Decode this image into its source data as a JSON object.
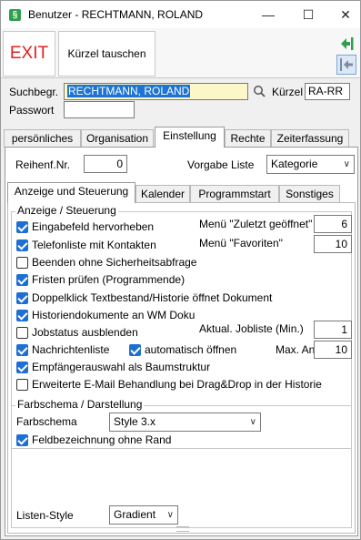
{
  "window": {
    "title": "Benutzer - RECHTMANN, ROLAND",
    "icon_glyph": "§",
    "controls": {
      "minimize": "—",
      "maximize": "☐",
      "close": "✕"
    }
  },
  "toolbar": {
    "exit_label": "EXIT",
    "kuerzel_tauschen_label": "Kürzel tauschen",
    "arrow_icons": [
      "arrow-in-icon",
      "arrow-out-icon"
    ]
  },
  "search": {
    "label": "Suchbegr.",
    "value": "RECHTMANN, ROLAND",
    "kuerzel_label": "Kürzel",
    "kuerzel_value": "RA-RR",
    "passwort_label": "Passwort",
    "passwort_value": ""
  },
  "main_tabs": [
    "persönliches",
    "Organisation",
    "Einstellung",
    "Rechte",
    "Zeiterfassung"
  ],
  "main_tab_active": "Einstellung",
  "einstellung": {
    "reihenf_label": "Reihenf.Nr.",
    "reihenf_value": "0",
    "vorgabe_label": "Vorgabe Liste",
    "vorgabe_value": "Kategorie"
  },
  "sub_tabs": [
    "Anzeige und Steuerung",
    "Kalender",
    "Programmstart",
    "Sonstiges"
  ],
  "sub_tab_active": "Anzeige und Steuerung",
  "anzeige": {
    "group_title": "Anzeige / Steuerung",
    "checkboxes": [
      {
        "label": "Eingabefeld hervorheben",
        "checked": true
      },
      {
        "label": "Telefonliste mit Kontakten",
        "checked": true
      },
      {
        "label": "Beenden ohne Sicherheitsabfrage",
        "checked": false
      },
      {
        "label": "Fristen prüfen (Programmende)",
        "checked": true
      },
      {
        "label": "Doppelklick Textbestand/Historie öffnet Dokument",
        "checked": true
      },
      {
        "label": "Historiendokumente an WM Doku",
        "checked": true
      },
      {
        "label": "Jobstatus ausblenden",
        "checked": false
      },
      {
        "label": "Nachrichtenliste",
        "checked": true
      },
      {
        "label": "automatisch öffnen",
        "checked": true
      },
      {
        "label": "Empfängerauswahl als Baumstruktur",
        "checked": true
      },
      {
        "label": "Erweiterte E-Mail Behandlung bei Drag&Drop in der Historie",
        "checked": false
      }
    ],
    "menue_zuletzt_label": "Menü \"Zuletzt geöffnet\"",
    "menue_zuletzt_value": "6",
    "menue_favoriten_label": "Menü \"Favoriten\"",
    "menue_favoriten_value": "10",
    "jobliste_label": "Aktual. Jobliste (Min.)",
    "jobliste_value": "1",
    "max_anzahl_label": "Max. Anzahl",
    "max_anzahl_value": "10"
  },
  "farbschema": {
    "group_title": "Farbschema / Darstellung",
    "label": "Farbschema",
    "value": "Style 3.x",
    "feldbezeichnung_label": "Feldbezeichnung ohne Rand",
    "feldbezeichnung_checked": true,
    "listen_style_label": "Listen-Style",
    "listen_style_value": "Gradient"
  },
  "colors": {
    "accent": "#1e6fd2",
    "exit_red": "#e02020",
    "highlight_field": "#fbf7c8",
    "arrow_green": "#2e9e4f"
  }
}
